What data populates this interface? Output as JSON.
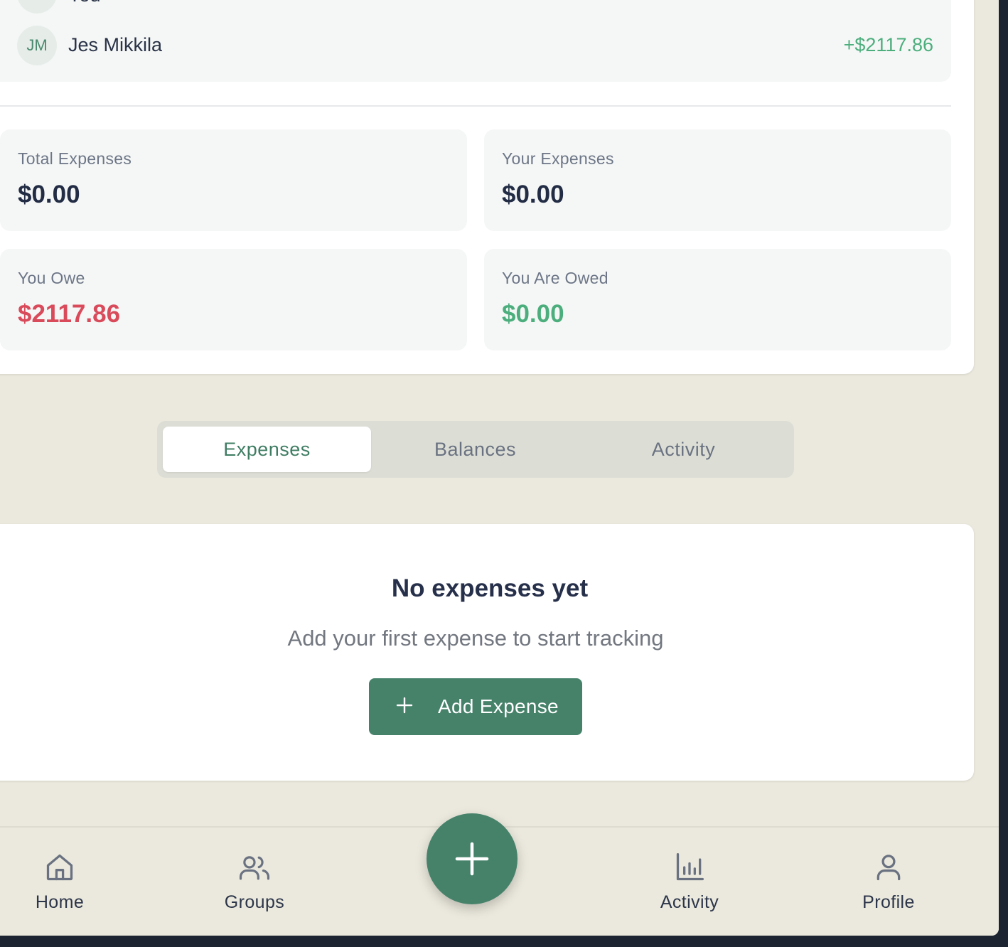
{
  "members": [
    {
      "initials": "",
      "name": "You",
      "amount": ""
    },
    {
      "initials": "JM",
      "name": "Jes Mikkila",
      "amount": "+$2117.86"
    }
  ],
  "stats": {
    "total_expenses": {
      "label": "Total Expenses",
      "value": "$0.00"
    },
    "your_expenses": {
      "label": "Your Expenses",
      "value": "$0.00"
    },
    "you_owe": {
      "label": "You Owe",
      "value": "$2117.86"
    },
    "you_are_owed": {
      "label": "You Are Owed",
      "value": "$0.00"
    }
  },
  "tabs": [
    {
      "label": "Expenses",
      "active": true
    },
    {
      "label": "Balances",
      "active": false
    },
    {
      "label": "Activity",
      "active": false
    }
  ],
  "empty_state": {
    "title": "No expenses yet",
    "subtitle": "Add your first expense to start tracking",
    "button_label": "Add Expense"
  },
  "bottom_nav": [
    {
      "label": "Home",
      "icon": "home-icon"
    },
    {
      "label": "Groups",
      "icon": "users-icon"
    },
    {
      "label": "Activity",
      "icon": "bar-chart-icon"
    },
    {
      "label": "Profile",
      "icon": "user-icon"
    }
  ],
  "colors": {
    "accent": "#46826a",
    "positive": "#4cae7d",
    "negative": "#d94a5a",
    "background": "#ebe9dd"
  }
}
